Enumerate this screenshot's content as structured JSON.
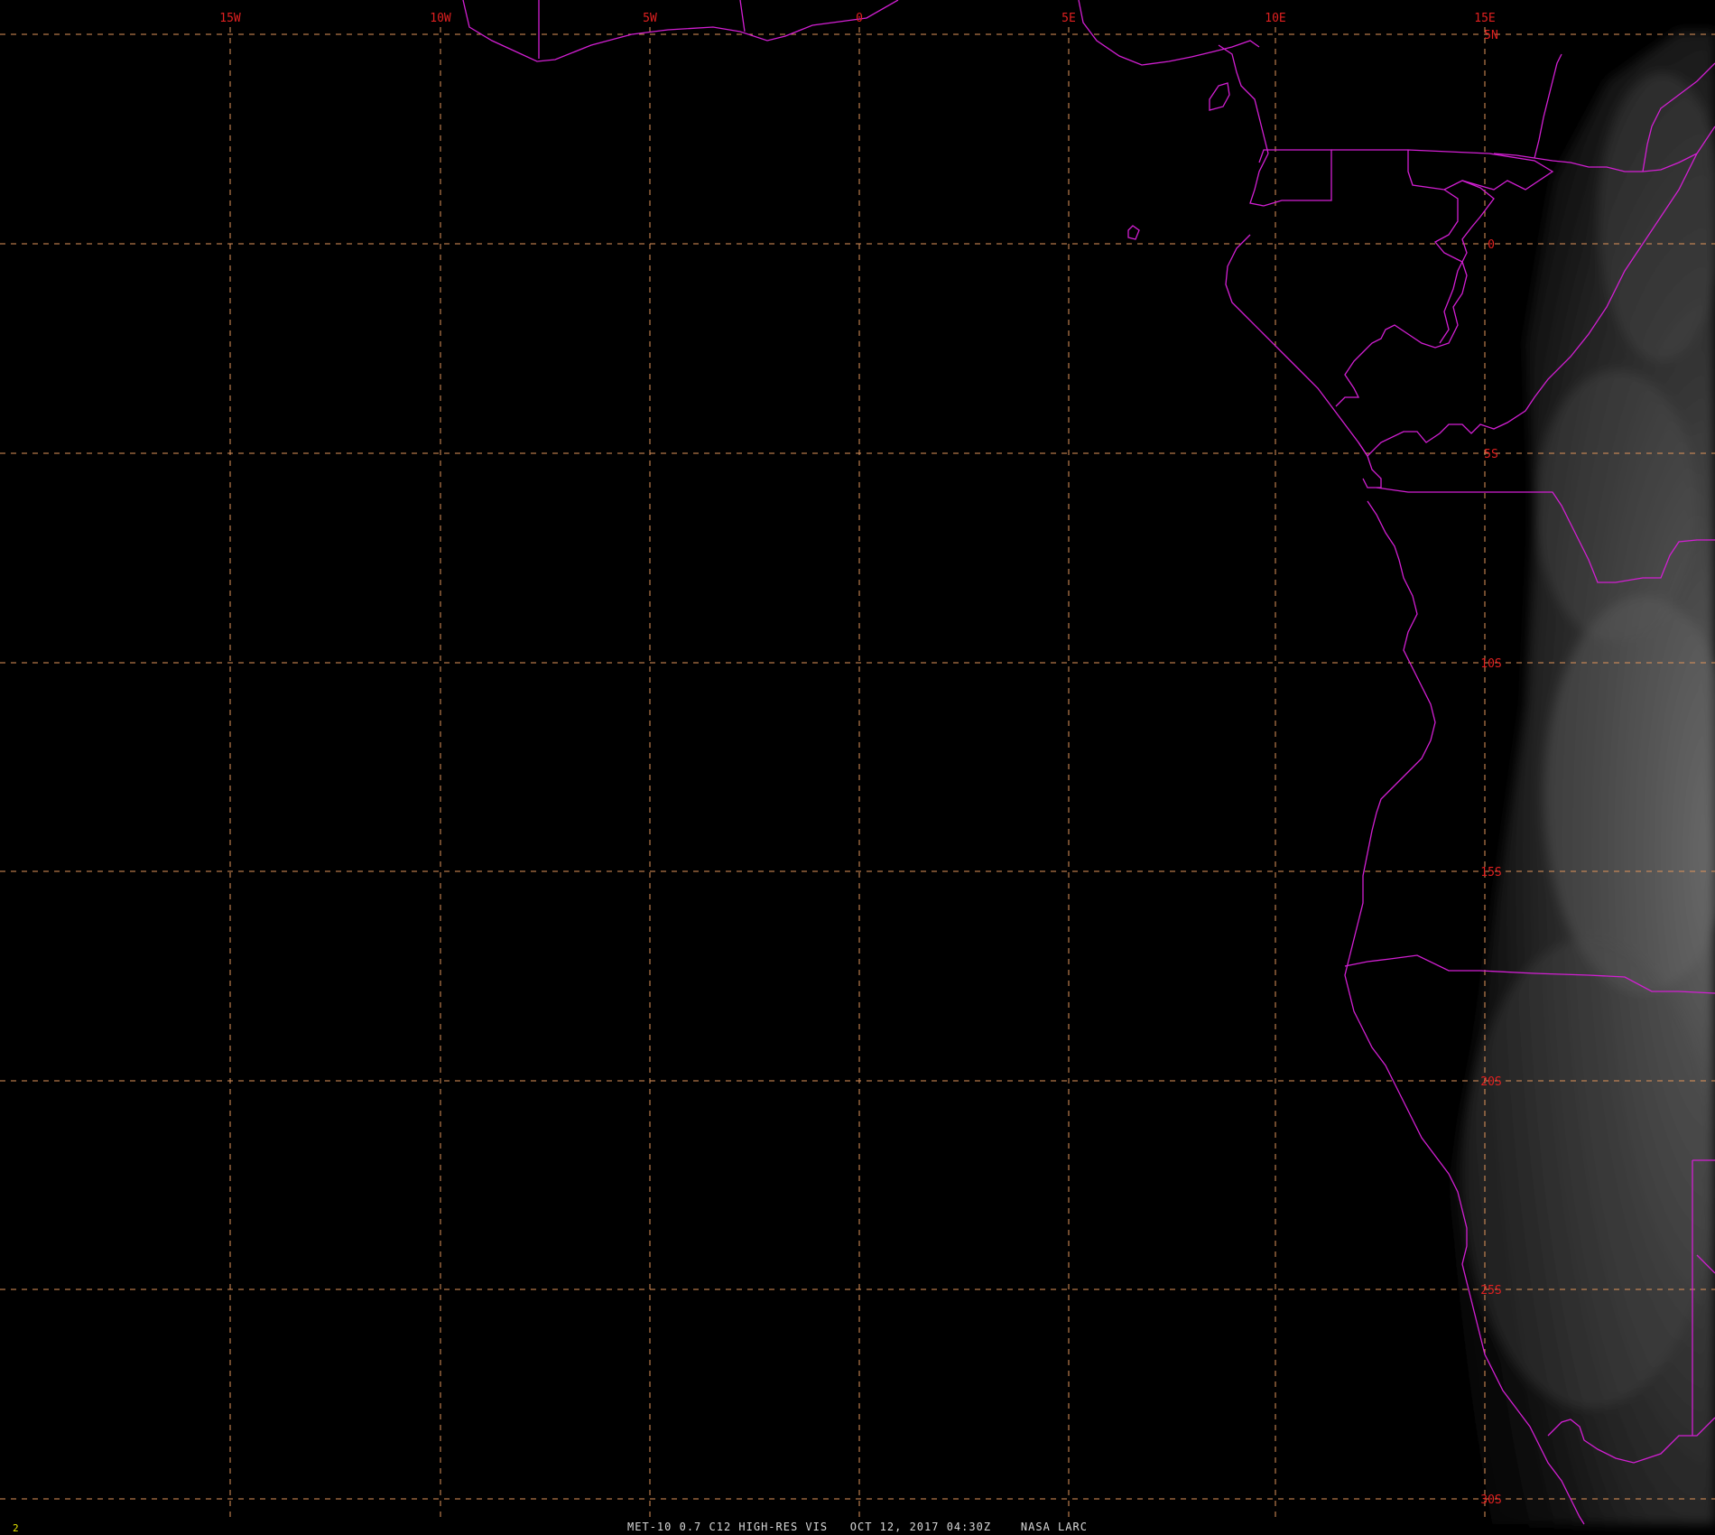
{
  "map": {
    "colors": {
      "background": "#000000",
      "grid": "#e0945a",
      "labels": "#e02020",
      "boundaries": "#d21fd2",
      "clouds": "#9a9a9a",
      "frame_number": "#e6e600",
      "caption": "#d8d8d8"
    },
    "longitude_labels": [
      "15W",
      "10W",
      "5W",
      "0",
      "5E",
      "10E",
      "15E"
    ],
    "latitude_labels": [
      "5N",
      "0",
      "5S",
      "10S",
      "15S",
      "20S",
      "25S",
      "30S"
    ]
  },
  "frame_number": "2",
  "caption": "MET-10 0.7 C12 HIGH-RES VIS   OCT 12, 2017 04:30Z    NASA LARC"
}
